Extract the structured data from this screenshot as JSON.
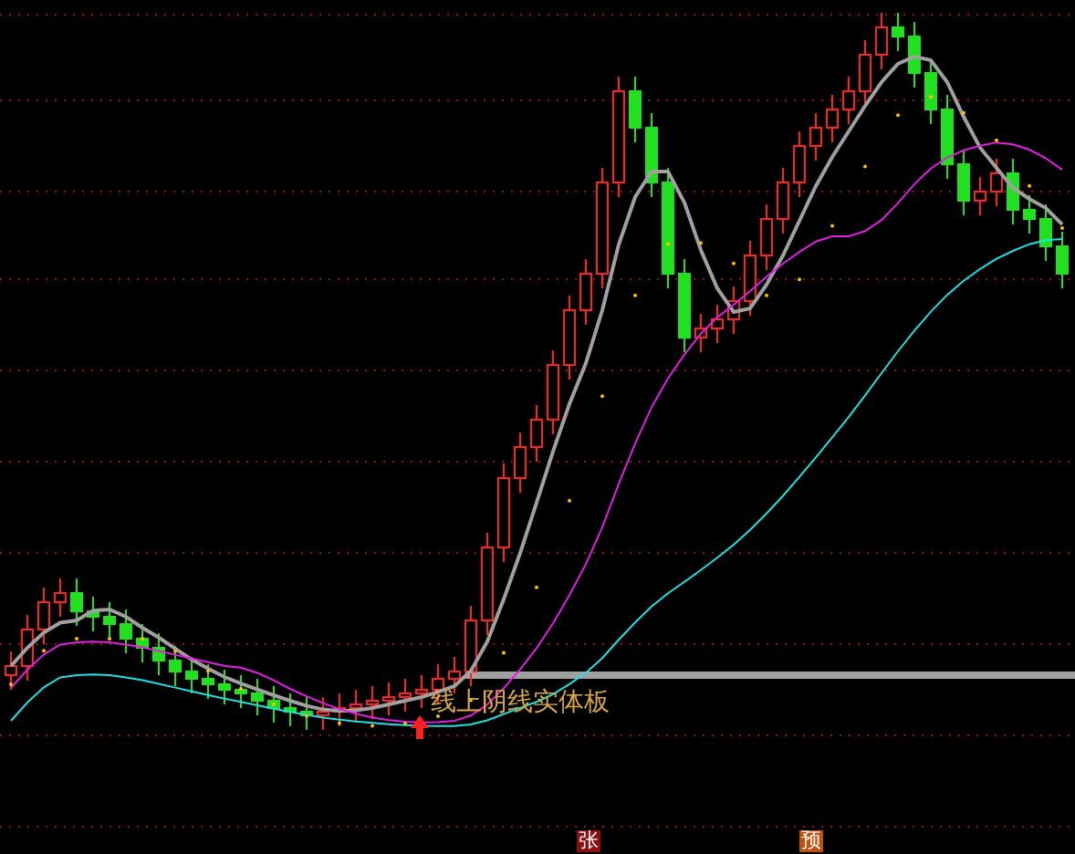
{
  "annotation": {
    "text": "线上阴线实体板"
  },
  "badges": [
    {
      "text": "张",
      "color": "#8b1010"
    },
    {
      "text": "预",
      "color": "#c05010"
    }
  ]
}
